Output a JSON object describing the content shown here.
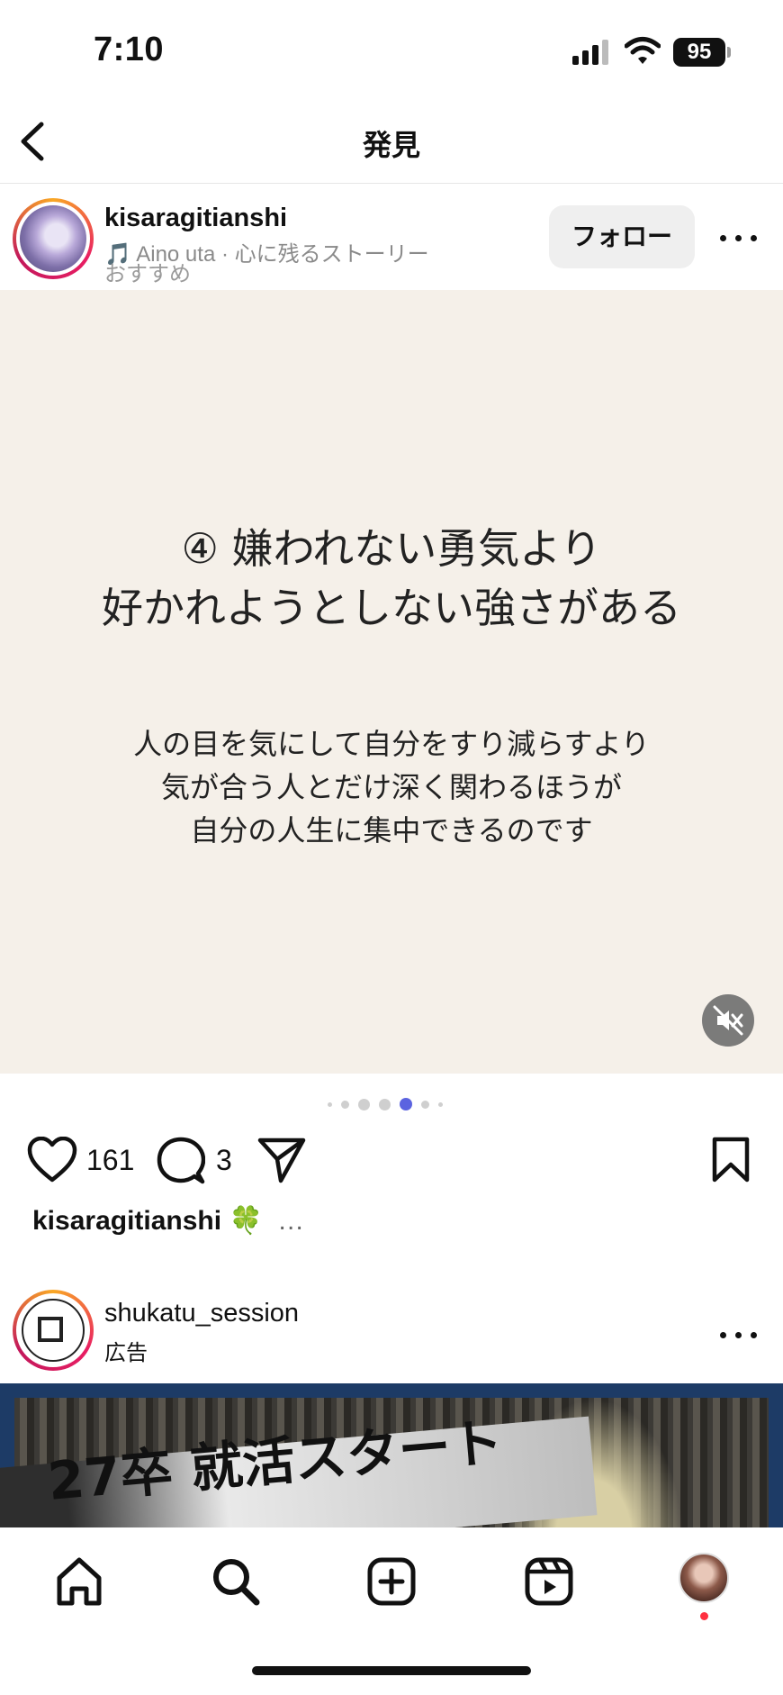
{
  "status_bar": {
    "time": "7:10",
    "battery": "95"
  },
  "header": {
    "title": "発見",
    "back_icon": "chevron-left-icon"
  },
  "post": {
    "username": "kisaragitianshi",
    "music": "🎵 Aino uta · 心に残るストーリー",
    "subtitle": "おすすめ",
    "follow_label": "フォロー",
    "slide": {
      "headline_line1": "④ 嫌われない勇気より",
      "headline_line2": "好かれようとしない強さがある",
      "body_line1": "人の目を気にして自分をすり減らすより",
      "body_line2": "気が合う人とだけ深く関わるほうが",
      "body_line3": "自分の人生に集中できるのです"
    },
    "carousel": {
      "total_dots": 7,
      "active_index": 4
    },
    "likes": "161",
    "comments": "3",
    "caption_user": "kisaragitianshi",
    "caption_emoji": "🍀",
    "caption_more": "…",
    "icons": [
      "heart-icon",
      "comment-icon",
      "share-icon",
      "bookmark-icon",
      "mute-icon",
      "more-icon"
    ]
  },
  "ad_post": {
    "username": "shukatu_session",
    "label": "広告",
    "banner_text": "27卒 就活スタート"
  },
  "tab_bar": {
    "items": [
      "home-icon",
      "search-icon",
      "create-icon",
      "reels-icon",
      "profile-avatar"
    ],
    "accent": "#ff3040"
  },
  "colors": {
    "slide_background": "#f5f0e9",
    "carousel_active": "#5b63e0",
    "follow_button": "#efefef"
  }
}
